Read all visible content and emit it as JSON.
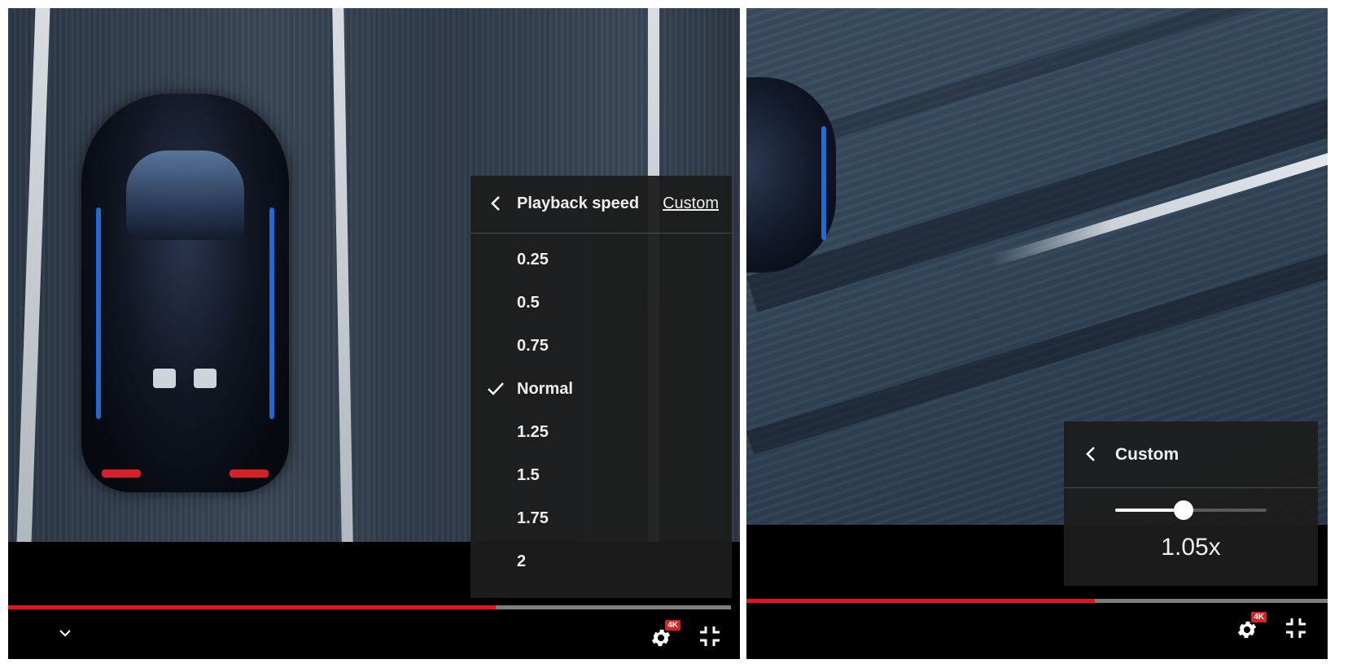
{
  "left_player": {
    "speed_menu": {
      "title": "Playback speed",
      "custom_link": "Custom",
      "options": [
        {
          "label": "0.25",
          "selected": false
        },
        {
          "label": "0.5",
          "selected": false
        },
        {
          "label": "0.75",
          "selected": false
        },
        {
          "label": "Normal",
          "selected": true
        },
        {
          "label": "1.25",
          "selected": false
        },
        {
          "label": "1.5",
          "selected": false
        },
        {
          "label": "1.75",
          "selected": false
        },
        {
          "label": "2",
          "selected": false
        }
      ]
    },
    "progress": 0.675,
    "quality_badge": "4K",
    "icons": [
      "chevron-down-icon",
      "settings-gear-icon",
      "exit-fullscreen-icon"
    ]
  },
  "right_player": {
    "custom_menu": {
      "title": "Custom",
      "speed_value": "1.05x",
      "slider_fraction": 0.45
    },
    "progress": 0.6,
    "quality_badge": "4K",
    "icons": [
      "settings-gear-icon",
      "exit-fullscreen-icon"
    ]
  },
  "colors": {
    "progress_played": "#e8141c",
    "progress_track": "#7f7f7f",
    "menu_background": "#1c1c1c",
    "badge": "#e0201f"
  }
}
